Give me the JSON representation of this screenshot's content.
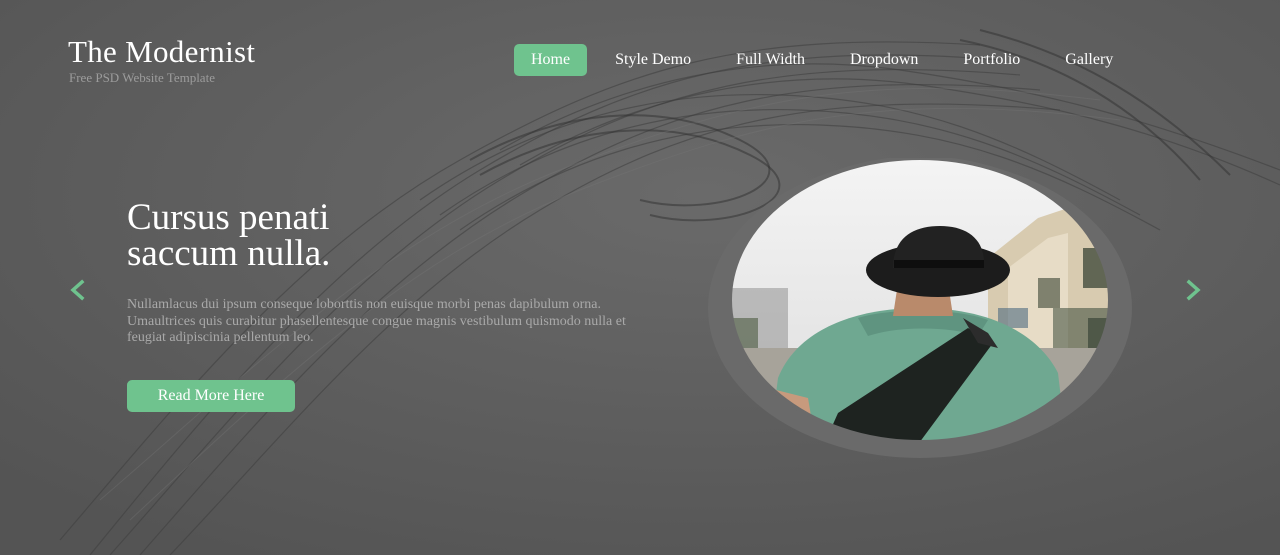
{
  "site": {
    "title": "The Modernist",
    "tagline": "Free PSD Website Template"
  },
  "nav": {
    "items": [
      {
        "label": "Home",
        "active": true
      },
      {
        "label": "Style Demo"
      },
      {
        "label": "Full Width"
      },
      {
        "label": "Dropdown"
      },
      {
        "label": "Portfolio"
      },
      {
        "label": "Gallery"
      }
    ]
  },
  "hero": {
    "headline_line1": "Cursus penati",
    "headline_line2": "saccum nulla.",
    "body": "Nullamlacus dui ipsum conseque loborttis non euisque morbi penas dapibulum orna. Umaultrices quis curabitur phasellentesque congue magnis vestibulum quismodo nulla et feugiat adipiscinia pellentum leo.",
    "cta_label": "Read More Here"
  },
  "slider": {
    "prev_icon": "chevron-left-icon",
    "next_icon": "chevron-right-icon"
  },
  "colors": {
    "accent": "#6fc38e",
    "background": "#595959"
  }
}
